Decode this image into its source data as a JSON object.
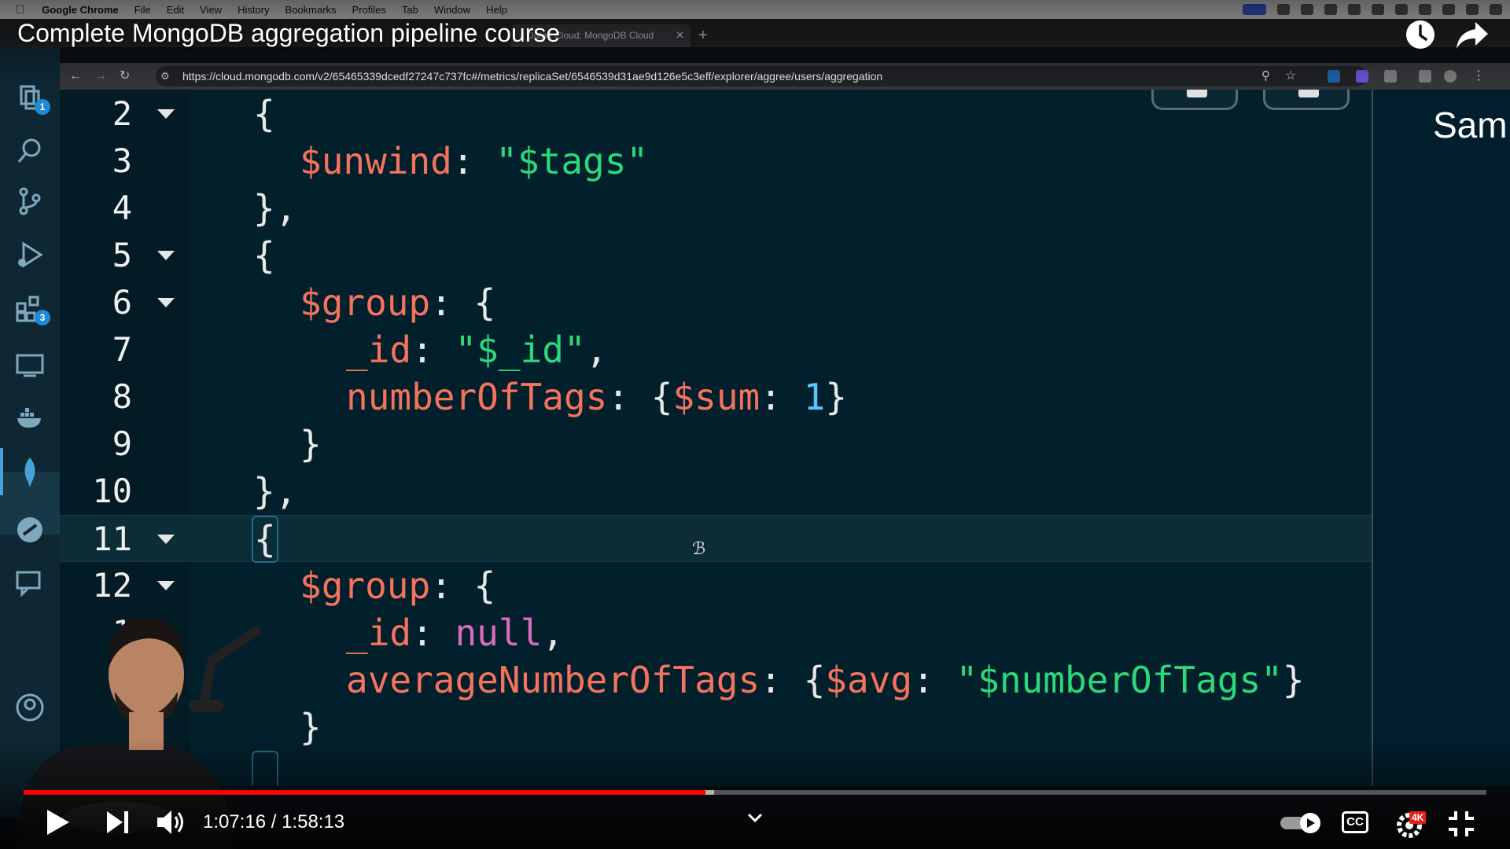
{
  "menubar": {
    "app": "Google Chrome",
    "items": [
      "File",
      "Edit",
      "View",
      "History",
      "Bookmarks",
      "Profiles",
      "Tab",
      "Window",
      "Help"
    ]
  },
  "browser": {
    "active_tab_title": "Data | Cloud: MongoDB Cloud",
    "url": "https://cloud.mongodb.com/v2/65465339dcedf27247c737fc#/metrics/replicaSet/6546539d31ae9d126e5c3eff/explorer/aggree/users/aggregation"
  },
  "activity_badges": {
    "explorer": "1",
    "extensions": "3"
  },
  "editor": {
    "lines": [
      {
        "num": "2",
        "fold": true
      },
      {
        "num": "3",
        "fold": false
      },
      {
        "num": "4",
        "fold": false
      },
      {
        "num": "5",
        "fold": true
      },
      {
        "num": "6",
        "fold": true
      },
      {
        "num": "7",
        "fold": false
      },
      {
        "num": "8",
        "fold": false
      },
      {
        "num": "9",
        "fold": false
      },
      {
        "num": "10",
        "fold": false
      },
      {
        "num": "11",
        "fold": true
      },
      {
        "num": "12",
        "fold": true
      },
      {
        "num": "1",
        "fold": false
      },
      {
        "num": "1",
        "fold": false
      }
    ],
    "tokens": {
      "l2_brace": "{",
      "l3_key": "$unwind",
      "l3_colon": ": ",
      "l3_val": "\"$tags\"",
      "l4": "},",
      "l5_brace": "{",
      "l6_key": "$group",
      "l6_rest": ": {",
      "l7_key": "_id",
      "l7_colon": ": ",
      "l7_val": "\"$_id\"",
      "l7_comma": ",",
      "l8_key": "numberOfTags",
      "l8_mid": ": {",
      "l8_op": "$sum",
      "l8_colon": ": ",
      "l8_num": "1",
      "l8_end": "}",
      "l9": "}",
      "l10": "},",
      "l11_brace": "{",
      "l12_key": "$group",
      "l12_rest": ": {",
      "l13_key": "_id",
      "l13_colon": ": ",
      "l13_val": "null",
      "l13_comma": ",",
      "l14_key": "averageNumberOfTags",
      "l14_mid": ": {",
      "l14_op": "$avg",
      "l14_colon": ": ",
      "l14_val": "\"$numberOfTags\"",
      "l14_end": "}",
      "l15": "}"
    }
  },
  "right_panel": {
    "text": "Sam"
  },
  "video": {
    "title": "Complete MongoDB aggregation pipeline course",
    "time": "1:07:16 / 1:58:13",
    "progress": 0.466,
    "buffered": 0.472,
    "quality_badge": "4K",
    "cc_label": "CC"
  },
  "colors": {
    "editor_bg": "#02202c",
    "key": "#f5735d",
    "string": "#2cd87a",
    "number": "#5cc3ff",
    "null": "#d86cc0",
    "progress": "#ff0000"
  }
}
